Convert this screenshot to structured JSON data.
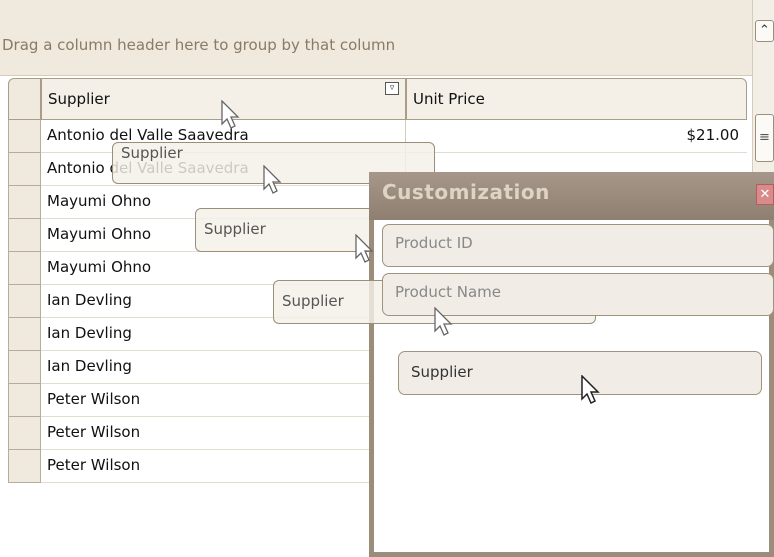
{
  "group_panel": {
    "hint": "Drag a column header here to group by that column"
  },
  "columns": {
    "supplier": "Supplier",
    "unit_price": "Unit Price"
  },
  "rows": [
    {
      "supplier": "Antonio del Valle Saavedra",
      "unit_price": "$21.00"
    },
    {
      "supplier": "Antonio del Valle Saavedra",
      "unit_price": ""
    },
    {
      "supplier": "Mayumi Ohno",
      "unit_price": ""
    },
    {
      "supplier": "Mayumi Ohno",
      "unit_price": ""
    },
    {
      "supplier": "Mayumi Ohno",
      "unit_price": ""
    },
    {
      "supplier": "Ian Devling",
      "unit_price": ""
    },
    {
      "supplier": "Ian Devling",
      "unit_price": ""
    },
    {
      "supplier": "Ian Devling",
      "unit_price": ""
    },
    {
      "supplier": "Peter Wilson",
      "unit_price": ""
    },
    {
      "supplier": "Peter Wilson",
      "unit_price": ""
    },
    {
      "supplier": "Peter Wilson",
      "unit_price": ""
    }
  ],
  "drag_ghosts": [
    "Supplier",
    "Supplier",
    "Supplier"
  ],
  "customization": {
    "title": "Customization",
    "items": [
      "Product ID",
      "Product Name",
      "Supplier"
    ]
  },
  "icons": {
    "filter": "filter-dropdown-icon",
    "close": "close-icon",
    "scroll_up": "chevron-up-icon",
    "scroll_thumb": "scroll-grip-icon",
    "cursor": "arrow-cursor-icon"
  },
  "colors": {
    "panel_bg": "#efe9de",
    "window_frame": "#9c8c7a",
    "close": "#d98a8a"
  }
}
